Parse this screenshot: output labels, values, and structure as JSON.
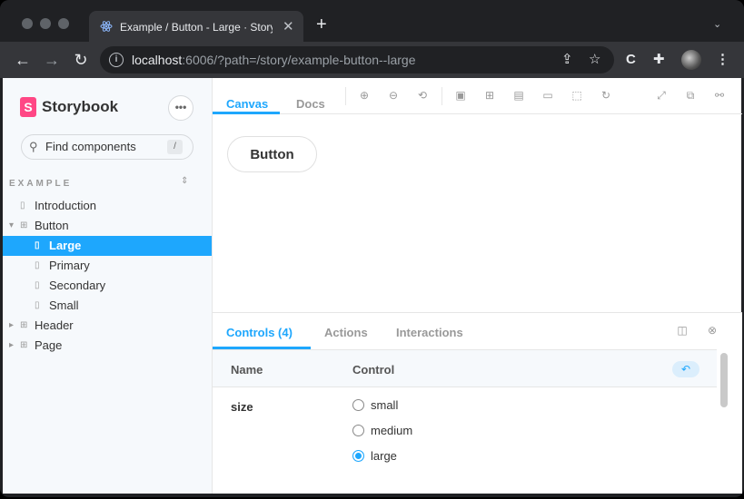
{
  "browser": {
    "tab_title": "Example / Button - Large · Storybook",
    "tab_close": "✕",
    "new_tab": "+",
    "url_host": "localhost",
    "url_rest": ":6006/?path=/story/example-button--large",
    "icons": [
      "back-icon",
      "forward-icon",
      "reload-icon",
      "info-icon",
      "share-icon",
      "star-icon",
      "extension-c-icon",
      "puzzle-icon",
      "avatar",
      "kebab-menu-icon"
    ]
  },
  "sidebar": {
    "logo": "Storybook",
    "menu_label": "•••",
    "search_placeholder": "Find components",
    "search_shortcut": "/",
    "group": "EXAMPLE",
    "items": [
      {
        "label": "Introduction",
        "selected": false
      },
      {
        "label": "Button",
        "selected": false
      },
      {
        "label": "Large",
        "selected": true
      },
      {
        "label": "Primary",
        "selected": false
      },
      {
        "label": "Secondary",
        "selected": false
      },
      {
        "label": "Small",
        "selected": false
      },
      {
        "label": "Header",
        "selected": false
      },
      {
        "label": "Page",
        "selected": false
      }
    ]
  },
  "canvas": {
    "tabs": [
      "Canvas",
      "Docs"
    ],
    "active_tab": "Canvas",
    "story_button": "Button"
  },
  "addons": {
    "tabs": [
      "Controls (4)",
      "Actions",
      "Interactions"
    ],
    "active_tab": "Controls (4)",
    "col_name": "Name",
    "col_control": "Control",
    "arg_name": "size",
    "options": [
      "small",
      "medium",
      "large"
    ],
    "selected_option": "large"
  },
  "colors": {
    "accent": "#1ea7fd",
    "brand": "#ff4785"
  }
}
